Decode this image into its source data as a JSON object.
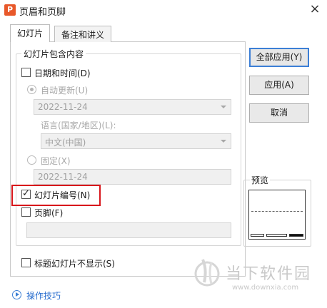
{
  "window": {
    "title": "页眉和页脚",
    "app_icon_letter": "P",
    "close_symbol": "×",
    "accent_color": "#e8582a"
  },
  "tabs": [
    {
      "label": "幻灯片",
      "active": true
    },
    {
      "label": "备注和讲义",
      "active": false
    }
  ],
  "group": {
    "legend": "幻灯片包含内容",
    "datetime": {
      "label": "日期和时间(D)",
      "checked": false,
      "auto_update": {
        "label": "自动更新(U)",
        "selected": true,
        "date_value": "2022-11-24"
      },
      "language": {
        "label": "语言(国家/地区)(L):",
        "value": "中文(中国)"
      },
      "fixed": {
        "label": "固定(X)",
        "selected": false,
        "value": "2022-11-24"
      }
    },
    "slide_number": {
      "label": "幻灯片编号(N)",
      "checked": true
    },
    "footer": {
      "label": "页脚(F)",
      "checked": false,
      "value": ""
    }
  },
  "hide_on_title": {
    "label": "标题幻灯片不显示(S)",
    "checked": false
  },
  "buttons": {
    "apply_all": "全部应用(Y)",
    "apply": "应用(A)",
    "cancel": "取消"
  },
  "preview": {
    "label": "预览"
  },
  "footer_link": "操作技巧",
  "watermark": {
    "text": "当下软件园",
    "url": "www.downxia.com"
  }
}
